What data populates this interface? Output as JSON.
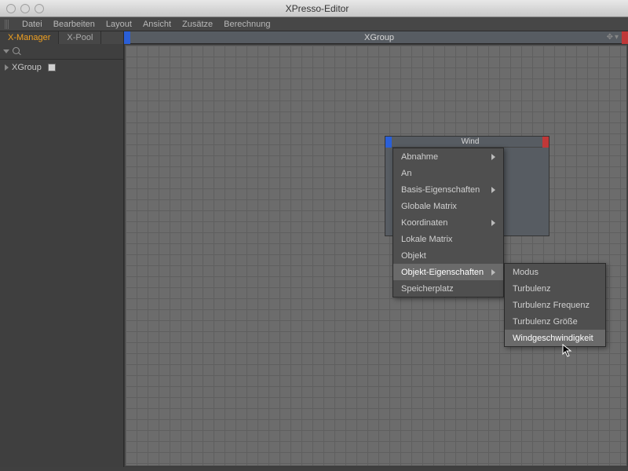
{
  "window": {
    "title": "XPresso-Editor"
  },
  "menu": {
    "items": [
      "Datei",
      "Bearbeiten",
      "Layout",
      "Ansicht",
      "Zusätze",
      "Berechnung"
    ]
  },
  "tabs": {
    "active": "X-Manager",
    "inactive": "X-Pool"
  },
  "tree": {
    "root": "XGroup"
  },
  "xgroup": {
    "title": "XGroup"
  },
  "node": {
    "title": "Wind"
  },
  "ctx": {
    "items": [
      {
        "label": "Abnahme",
        "sub": true
      },
      {
        "label": "An",
        "sub": false
      },
      {
        "label": "Basis-Eigenschaften",
        "sub": true
      },
      {
        "label": "Globale Matrix",
        "sub": false
      },
      {
        "label": "Koordinaten",
        "sub": true
      },
      {
        "label": "Lokale Matrix",
        "sub": false
      },
      {
        "label": "Objekt",
        "sub": false
      },
      {
        "label": "Objekt-Eigenschaften",
        "sub": true,
        "hi": true
      },
      {
        "label": "Speicherplatz",
        "sub": false
      }
    ]
  },
  "subctx": {
    "items": [
      {
        "label": "Modus"
      },
      {
        "label": "Turbulenz"
      },
      {
        "label": "Turbulenz Frequenz"
      },
      {
        "label": "Turbulenz Größe"
      },
      {
        "label": "Windgeschwindigkeit",
        "hi": true
      }
    ]
  }
}
